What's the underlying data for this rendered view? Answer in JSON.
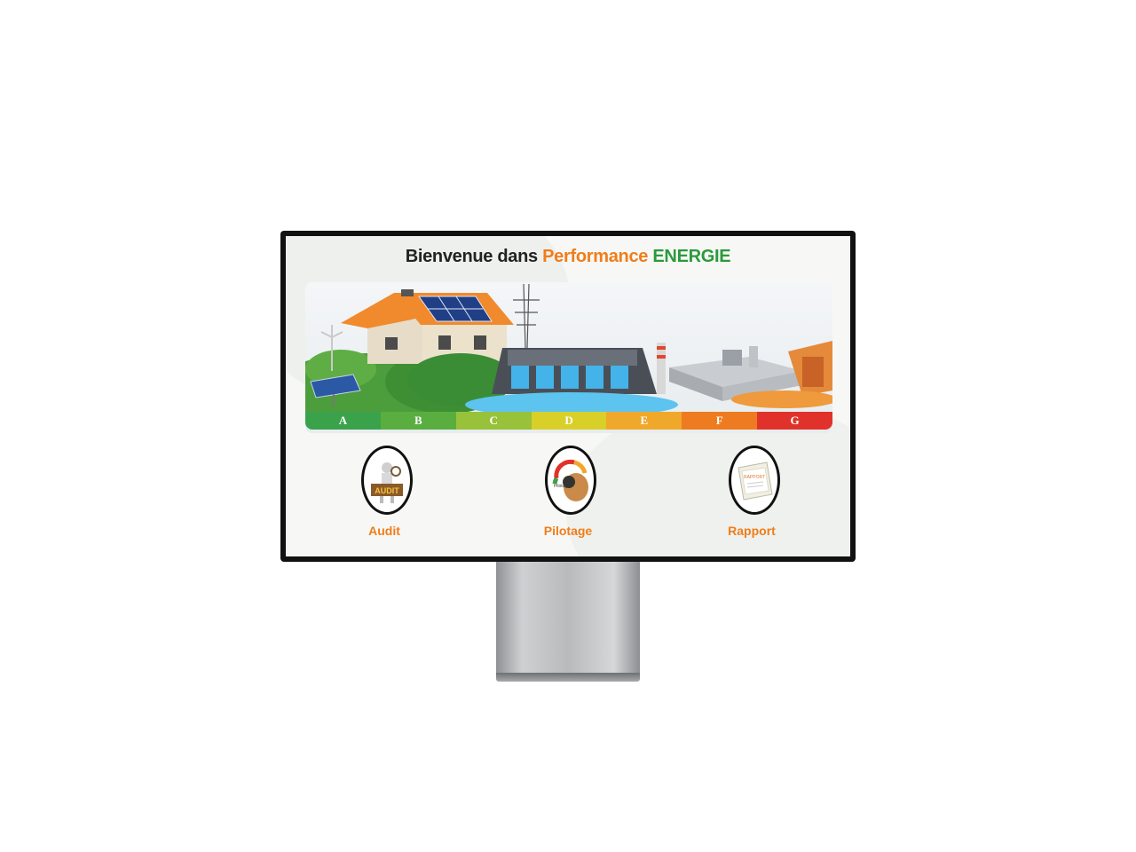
{
  "header": {
    "welcome": "Bienvenue dans",
    "brand_orange": "Performance",
    "brand_green": "ENERGIE"
  },
  "energy_scale": {
    "classes": [
      {
        "letter": "A",
        "color": "#3aa24a"
      },
      {
        "letter": "B",
        "color": "#59ae3f"
      },
      {
        "letter": "C",
        "color": "#97c23a"
      },
      {
        "letter": "D",
        "color": "#d9cf29"
      },
      {
        "letter": "E",
        "color": "#f0a82a"
      },
      {
        "letter": "F",
        "color": "#ee7b1f"
      },
      {
        "letter": "G",
        "color": "#e0322a"
      }
    ]
  },
  "modules": [
    {
      "label": "Audit",
      "icon": "audit-icon",
      "icon_text": "AUDIT"
    },
    {
      "label": "Pilotage",
      "icon": "pilotage-gauge-icon",
      "icon_text": "Pilotage"
    },
    {
      "label": "Rapport",
      "icon": "report-document-icon",
      "icon_text": "RAPPORT"
    }
  ],
  "colors": {
    "accent_orange": "#f07d1a",
    "accent_green": "#2b9a3c",
    "frame": "#111111"
  }
}
